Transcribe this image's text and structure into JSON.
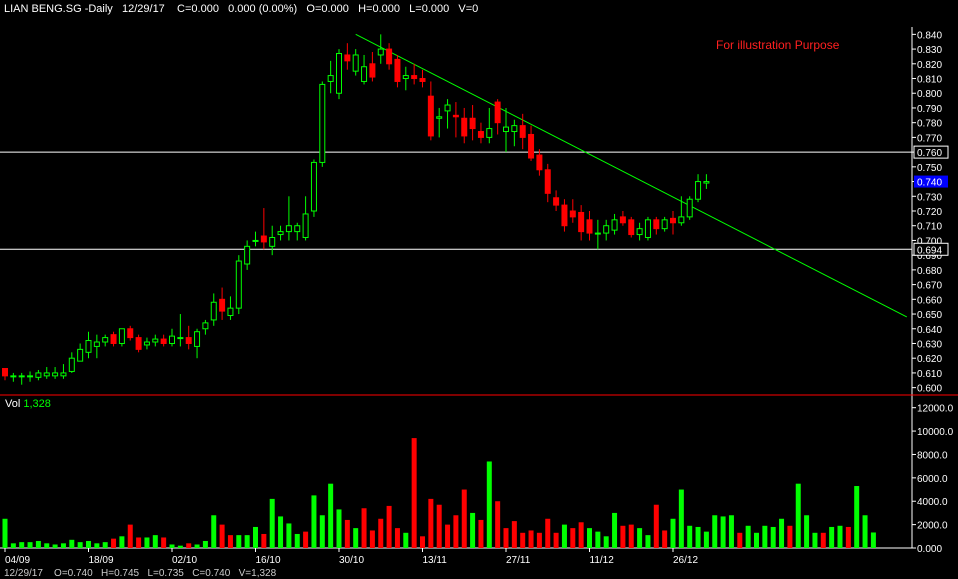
{
  "header": {
    "symbol": "LIAN BENG.SG -Daily",
    "date": "12/29/17",
    "change": "C=0.000",
    "change_pct": "0.000 (0.00%)",
    "open": "O=0.000",
    "high": "H=0.000",
    "low": "L=0.000",
    "volume": "V=0"
  },
  "note": "For illustration Purpose",
  "volume_label": "Vol",
  "volume_value": "1,328",
  "status_text": "12/29/17    O=0.740   H=0.745   L=0.735   C=0.740   V=1,328",
  "colors": {
    "up": "#00ff00",
    "down": "#ff0000",
    "trendline": "#00ff00",
    "hline": "#ffffff",
    "axis": "#ffffff",
    "panel_separator": "#ff0000",
    "price_tag_bg": "#0000ff",
    "note": "#ff2020"
  },
  "chart_data": [
    {
      "type": "candlestick",
      "title": "LIAN BENG.SG -Daily",
      "ylim": [
        0.595,
        0.845
      ],
      "yticks": [
        "0.840",
        "0.830",
        "0.820",
        "0.810",
        "0.800",
        "0.790",
        "0.780",
        "0.770",
        "0.760",
        "0.750",
        "0.740",
        "0.730",
        "0.720",
        "0.710",
        "0.700",
        "0.690",
        "0.680",
        "0.670",
        "0.660",
        "0.650",
        "0.640",
        "0.630",
        "0.620",
        "0.610",
        "0.600"
      ],
      "x_tick_labels": [
        {
          "label": "04/09",
          "index": 0
        },
        {
          "label": "18/09",
          "index": 10
        },
        {
          "label": "02/10",
          "index": 20
        },
        {
          "label": "16/10",
          "index": 30
        },
        {
          "label": "30/10",
          "index": 40
        },
        {
          "label": "13/11",
          "index": 50
        },
        {
          "label": "27/11",
          "index": 60
        },
        {
          "label": "11/12",
          "index": 70
        },
        {
          "label": "26/12",
          "index": 80
        }
      ],
      "price_labels": [
        {
          "value": 0.76,
          "text": "0.760"
        },
        {
          "value": 0.74,
          "text": "0.740",
          "highlight": true
        },
        {
          "value": 0.694,
          "text": "0.694"
        }
      ],
      "hlines": [
        0.76,
        0.694
      ],
      "trendline": {
        "from": {
          "index": 42,
          "value": 0.84
        },
        "to": {
          "index": 108,
          "value": 0.648
        }
      },
      "ohlc": [
        [
          0.613,
          0.613,
          0.605,
          0.608
        ],
        [
          0.608,
          0.61,
          0.604,
          0.608
        ],
        [
          0.608,
          0.61,
          0.602,
          0.608
        ],
        [
          0.608,
          0.611,
          0.604,
          0.608
        ],
        [
          0.607,
          0.612,
          0.605,
          0.61
        ],
        [
          0.608,
          0.614,
          0.606,
          0.61
        ],
        [
          0.608,
          0.614,
          0.606,
          0.61
        ],
        [
          0.608,
          0.616,
          0.606,
          0.61
        ],
        [
          0.611,
          0.624,
          0.61,
          0.62
        ],
        [
          0.618,
          0.63,
          0.618,
          0.626
        ],
        [
          0.624,
          0.638,
          0.62,
          0.632
        ],
        [
          0.628,
          0.636,
          0.62,
          0.631
        ],
        [
          0.631,
          0.636,
          0.628,
          0.634
        ],
        [
          0.636,
          0.638,
          0.628,
          0.63
        ],
        [
          0.63,
          0.64,
          0.628,
          0.64
        ],
        [
          0.64,
          0.642,
          0.632,
          0.634
        ],
        [
          0.634,
          0.636,
          0.624,
          0.626
        ],
        [
          0.629,
          0.634,
          0.626,
          0.631
        ],
        [
          0.631,
          0.636,
          0.628,
          0.633
        ],
        [
          0.633,
          0.636,
          0.628,
          0.63
        ],
        [
          0.63,
          0.64,
          0.628,
          0.635
        ],
        [
          0.634,
          0.65,
          0.628,
          0.634
        ],
        [
          0.634,
          0.642,
          0.626,
          0.63
        ],
        [
          0.628,
          0.64,
          0.62,
          0.638
        ],
        [
          0.64,
          0.646,
          0.636,
          0.644
        ],
        [
          0.646,
          0.664,
          0.642,
          0.658
        ],
        [
          0.66,
          0.668,
          0.646,
          0.652
        ],
        [
          0.649,
          0.662,
          0.646,
          0.654
        ],
        [
          0.654,
          0.69,
          0.65,
          0.686
        ],
        [
          0.684,
          0.7,
          0.68,
          0.696
        ],
        [
          0.7,
          0.706,
          0.696,
          0.7
        ],
        [
          0.703,
          0.722,
          0.694,
          0.699
        ],
        [
          0.696,
          0.71,
          0.69,
          0.702
        ],
        [
          0.704,
          0.71,
          0.7,
          0.706
        ],
        [
          0.706,
          0.73,
          0.7,
          0.71
        ],
        [
          0.706,
          0.712,
          0.7,
          0.71
        ],
        [
          0.702,
          0.73,
          0.7,
          0.718
        ],
        [
          0.72,
          0.755,
          0.716,
          0.753
        ],
        [
          0.753,
          0.808,
          0.75,
          0.806
        ],
        [
          0.808,
          0.822,
          0.8,
          0.812
        ],
        [
          0.8,
          0.83,
          0.796,
          0.827
        ],
        [
          0.826,
          0.834,
          0.816,
          0.822
        ],
        [
          0.815,
          0.83,
          0.812,
          0.826
        ],
        [
          0.808,
          0.826,
          0.806,
          0.818
        ],
        [
          0.82,
          0.828,
          0.808,
          0.811
        ],
        [
          0.826,
          0.84,
          0.82,
          0.83
        ],
        [
          0.83,
          0.834,
          0.816,
          0.82
        ],
        [
          0.823,
          0.826,
          0.804,
          0.808
        ],
        [
          0.81,
          0.818,
          0.802,
          0.812
        ],
        [
          0.812,
          0.82,
          0.806,
          0.81
        ],
        [
          0.81,
          0.816,
          0.804,
          0.808
        ],
        [
          0.798,
          0.808,
          0.768,
          0.771
        ],
        [
          0.783,
          0.79,
          0.77,
          0.784
        ],
        [
          0.788,
          0.796,
          0.776,
          0.792
        ],
        [
          0.785,
          0.794,
          0.77,
          0.784
        ],
        [
          0.783,
          0.79,
          0.766,
          0.771
        ],
        [
          0.783,
          0.792,
          0.768,
          0.776
        ],
        [
          0.774,
          0.78,
          0.766,
          0.77
        ],
        [
          0.77,
          0.79,
          0.766,
          0.776
        ],
        [
          0.794,
          0.796,
          0.772,
          0.78
        ],
        [
          0.774,
          0.79,
          0.76,
          0.777
        ],
        [
          0.774,
          0.782,
          0.764,
          0.778
        ],
        [
          0.778,
          0.786,
          0.762,
          0.77
        ],
        [
          0.772,
          0.778,
          0.754,
          0.756
        ],
        [
          0.758,
          0.762,
          0.744,
          0.748
        ],
        [
          0.748,
          0.752,
          0.726,
          0.732
        ],
        [
          0.729,
          0.734,
          0.72,
          0.724
        ],
        [
          0.724,
          0.728,
          0.706,
          0.71
        ],
        [
          0.72,
          0.728,
          0.712,
          0.716
        ],
        [
          0.719,
          0.724,
          0.7,
          0.706
        ],
        [
          0.714,
          0.72,
          0.7,
          0.705
        ],
        [
          0.705,
          0.714,
          0.694,
          0.705
        ],
        [
          0.705,
          0.714,
          0.7,
          0.71
        ],
        [
          0.707,
          0.718,
          0.704,
          0.714
        ],
        [
          0.716,
          0.72,
          0.71,
          0.712
        ],
        [
          0.714,
          0.716,
          0.702,
          0.704
        ],
        [
          0.704,
          0.712,
          0.7,
          0.708
        ],
        [
          0.702,
          0.716,
          0.7,
          0.714
        ],
        [
          0.714,
          0.716,
          0.704,
          0.708
        ],
        [
          0.708,
          0.716,
          0.706,
          0.714
        ],
        [
          0.715,
          0.72,
          0.704,
          0.712
        ],
        [
          0.712,
          0.73,
          0.71,
          0.716
        ],
        [
          0.716,
          0.73,
          0.714,
          0.728
        ],
        [
          0.728,
          0.745,
          0.726,
          0.74
        ],
        [
          0.739,
          0.745,
          0.735,
          0.74
        ]
      ]
    },
    {
      "type": "bar",
      "title": "Vol",
      "ylim": [
        0,
        13000
      ],
      "yticks": [
        "12000.0",
        "10000.0",
        "8000.0",
        "6000.0",
        "4000.0",
        "2000.0",
        "0.000"
      ],
      "values": [
        2500,
        400,
        500,
        500,
        600,
        400,
        300,
        400,
        700,
        500,
        600,
        400,
        500,
        800,
        1000,
        2000,
        900,
        900,
        1100,
        900,
        300,
        200,
        400,
        300,
        600,
        2800,
        2000,
        1100,
        1100,
        1100,
        1800,
        1200,
        4200,
        2700,
        2100,
        1200,
        1400,
        4500,
        2800,
        5500,
        3300,
        2400,
        1700,
        3400,
        1500,
        2500,
        3600,
        1700,
        1300,
        9400,
        1000,
        4200,
        3700,
        2000,
        2800,
        5000,
        3000,
        2400,
        7400,
        4000,
        1700,
        2300,
        1300,
        1500,
        1300,
        2500,
        1300,
        2000,
        1700,
        2200,
        1700,
        1400,
        1000,
        3000,
        1900,
        2000,
        1700,
        1100,
        3700,
        1500,
        2500,
        5000,
        1900,
        1800,
        1400,
        2800,
        2700,
        2800,
        1300,
        1900,
        1300,
        1900,
        1800,
        2500,
        1900,
        5500,
        2800,
        1300,
        1300,
        1800,
        1900,
        1800,
        5300,
        2800,
        1328
      ],
      "directions": "GGGGGGGGGGGGGRGRRGGRGGRGGGRRGGGRGGGGRGGGGRGRRRRRGRRRRRRRGRGRRRRRRRRGRRGGGGRRGGRRGGGGGGGGRGGGGGRGGGRGGR"
    }
  ]
}
